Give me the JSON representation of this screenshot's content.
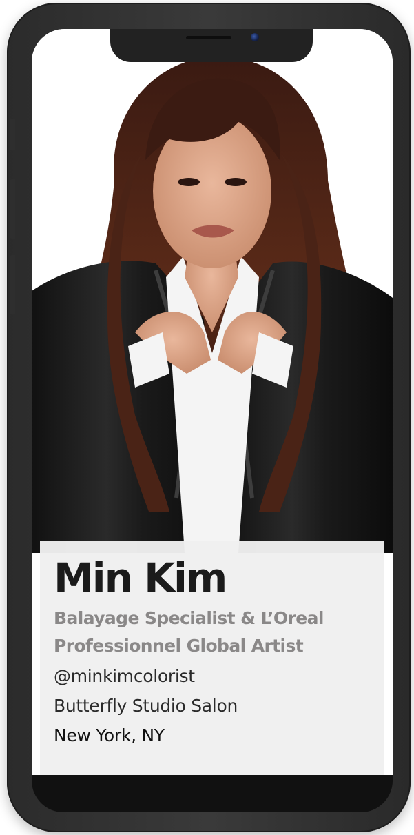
{
  "profile": {
    "name": "Min Kim",
    "title_line1": "Balayage Specialist & L’Oreal",
    "title_line2": "Professionnel Global Artist",
    "handle": "@minkimcolorist",
    "salon": "Butterfly Studio Salon",
    "location": "New York, NY"
  },
  "colors": {
    "frame": "#2b2b2b",
    "card": "#f0eff0",
    "name": "#1b1b1b",
    "title": "#8a8888",
    "detail": "#2a2a2a"
  },
  "icons": [
    "camera-icon",
    "speaker-icon"
  ]
}
